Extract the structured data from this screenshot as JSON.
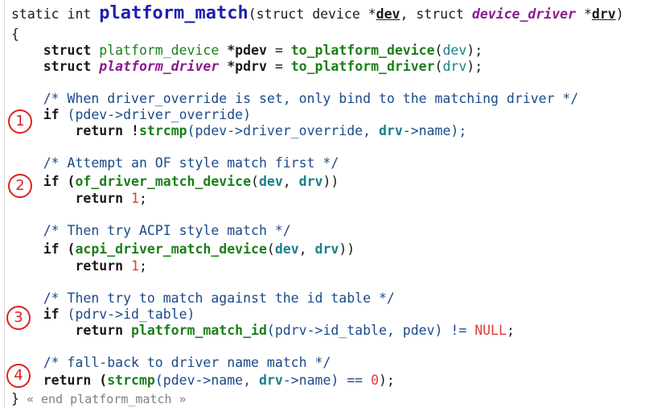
{
  "code": {
    "l1": {
      "a": "static int ",
      "b": "platform_match",
      "c": "(struct device *",
      "d": "dev",
      "e": ", struct ",
      "f": "device_driver",
      "g": " *",
      "h": "drv",
      "i": ")"
    },
    "l2": "{",
    "l3": {
      "a": "    struct ",
      "b": "platform_device",
      "c": " *",
      "d": "pdev",
      "e": " = ",
      "f": "to_platform_device",
      "g": "(",
      "h": "dev",
      "i": ");"
    },
    "l4": {
      "a": "    struct ",
      "b": "platform_driver",
      "c": " *",
      "d": "pdrv",
      "e": " = ",
      "f": "to_platform_driver",
      "g": "(",
      "h": "drv",
      "i": ");"
    },
    "l5": "    /* When driver_override is set, only bind to the matching driver */",
    "l6": {
      "a": "    if ",
      "b": "(pdev->driver_override)"
    },
    "l7": {
      "a": "        return !",
      "b": "strcmp",
      "c": "(pdev->driver_override, ",
      "d": "drv",
      "e": "->name);"
    },
    "l8": "    /* Attempt an OF style match first */",
    "l9": {
      "a": "    if (",
      "b": "of_driver_match_device",
      "c": "(",
      "d": "dev",
      "e": ", ",
      "f": "drv",
      "g": "))"
    },
    "l10": {
      "a": "        return ",
      "b": "1",
      "c": ";"
    },
    "l11": "    /* Then try ACPI style match */",
    "l12": {
      "a": "    if (",
      "b": "acpi_driver_match_device",
      "c": "(",
      "d": "dev",
      "e": ", ",
      "f": "drv",
      "g": "))"
    },
    "l13": {
      "a": "        return ",
      "b": "1",
      "c": ";"
    },
    "l14": "    /* Then try to match against the id table */",
    "l15": {
      "a": "    if ",
      "b": "(pdrv->id_table)"
    },
    "l16": {
      "a": "        return ",
      "b": "platform_match_id",
      "c": "(pdrv->id_table, pdev) != ",
      "d": "NULL",
      "e": ";"
    },
    "l17": "    /* fall-back to driver name match */",
    "l18": {
      "a": "    return (",
      "b": "strcmp",
      "c": "(pdev->name, ",
      "d": "drv",
      "e": "->name) == ",
      "f": "0",
      "g": ");"
    },
    "l19": {
      "a": "}",
      "b": " « end platform_match »"
    }
  },
  "markers": [
    "1",
    "2",
    "3",
    "4"
  ],
  "colors": {
    "function_name": "#1f1fb0",
    "call": "#1a7f1a",
    "type": "#8b1a8b",
    "variable": "#1a7f8a",
    "comment": "#1a4a8a",
    "number": "#e03a3a",
    "marker": "#e02020"
  }
}
